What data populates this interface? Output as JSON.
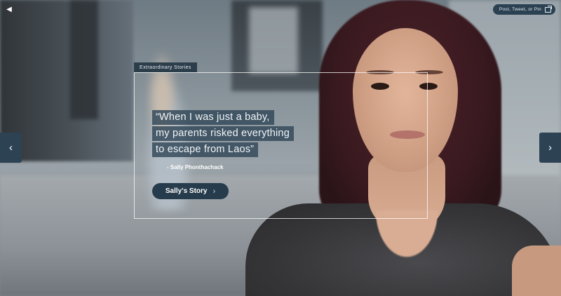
{
  "controls": {
    "mute_icon": "◀",
    "share_label": "Post, Tweet, or Pin",
    "prev_icon": "‹",
    "next_icon": "›"
  },
  "feature": {
    "tag": "Extraordinary Stories",
    "quote_lines": [
      "“When I was just a baby,",
      "my parents risked everything",
      "to escape from Laos”"
    ],
    "attribution": "- Sally Phonthachack",
    "cta_label": "Sally's Story",
    "cta_chevron": "›"
  },
  "colors": {
    "ui_dark_blue": "#2d4253",
    "frame_border": "#ffffff"
  }
}
